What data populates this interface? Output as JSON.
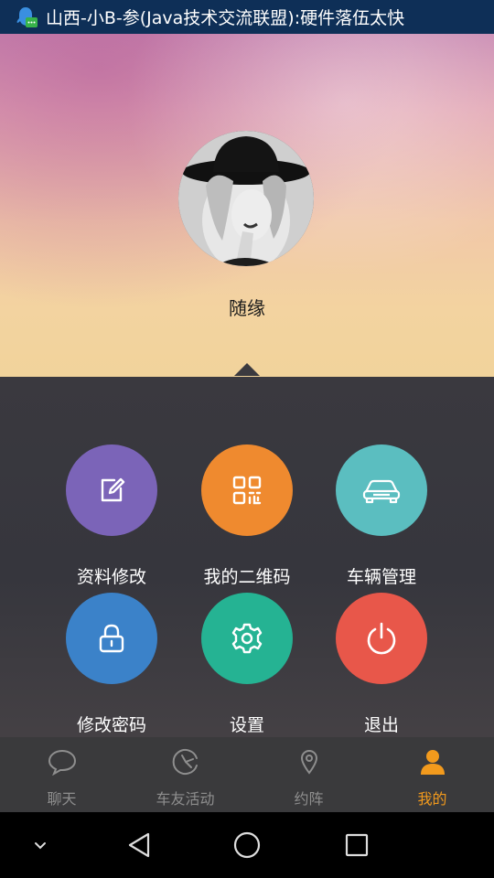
{
  "status_bar": {
    "icon": "qq-notification-icon",
    "text": "山西-小B-参(Java技术交流联盟):硬件落伍太快"
  },
  "profile": {
    "username": "随缘"
  },
  "menu": {
    "items": [
      {
        "label": "资料修改",
        "icon": "edit-icon",
        "color": "#7b64b8"
      },
      {
        "label": "我的二维码",
        "icon": "qr-code-icon",
        "color": "#ef8a2f"
      },
      {
        "label": "车辆管理",
        "icon": "car-icon",
        "color": "#5bbec0"
      },
      {
        "label": "修改密码",
        "icon": "lock-icon",
        "color": "#3b82c9"
      },
      {
        "label": "设置",
        "icon": "gear-icon",
        "color": "#25b393"
      },
      {
        "label": "退出",
        "icon": "power-icon",
        "color": "#e8574a"
      }
    ]
  },
  "tabbar": {
    "tabs": [
      {
        "label": "聊天",
        "icon": "chat-bubble-icon",
        "active": false
      },
      {
        "label": "车友活动",
        "icon": "activity-icon",
        "active": false
      },
      {
        "label": "约阵",
        "icon": "location-pin-icon",
        "active": false
      },
      {
        "label": "我的",
        "icon": "person-icon",
        "active": true
      }
    ],
    "inactive_color": "#8e8e8e",
    "active_color": "#f29a1d"
  },
  "nav_bar": {
    "buttons": [
      "collapse-icon",
      "back-icon",
      "home-icon",
      "recents-icon"
    ]
  }
}
